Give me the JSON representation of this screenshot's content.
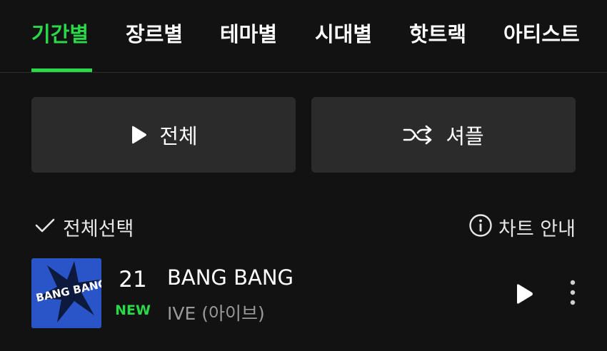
{
  "tabs": [
    {
      "label": "기간별",
      "active": true
    },
    {
      "label": "장르별",
      "active": false
    },
    {
      "label": "테마별",
      "active": false
    },
    {
      "label": "시대별",
      "active": false
    },
    {
      "label": "핫트랙",
      "active": false
    },
    {
      "label": "아티스트",
      "active": false
    }
  ],
  "actions": {
    "play_all_label": "전체",
    "shuffle_label": "셔플"
  },
  "list_controls": {
    "select_all_label": "전체선택",
    "chart_guide_label": "차트 안내"
  },
  "songs": [
    {
      "rank": "21",
      "status": "NEW",
      "title": "BANG BANG",
      "artist": "IVE (아이브)",
      "album_art_text": "BANG BANG"
    }
  ],
  "colors": {
    "background": "#121212",
    "accent": "#2ad94a",
    "button_bg": "#2b2b2b",
    "muted_text": "#9a9a9a",
    "album_bg": "#2a55c8"
  },
  "icons": {
    "play": "play-icon",
    "shuffle": "shuffle-icon",
    "check": "check-icon",
    "info": "info-icon",
    "more": "more-vertical-icon"
  }
}
